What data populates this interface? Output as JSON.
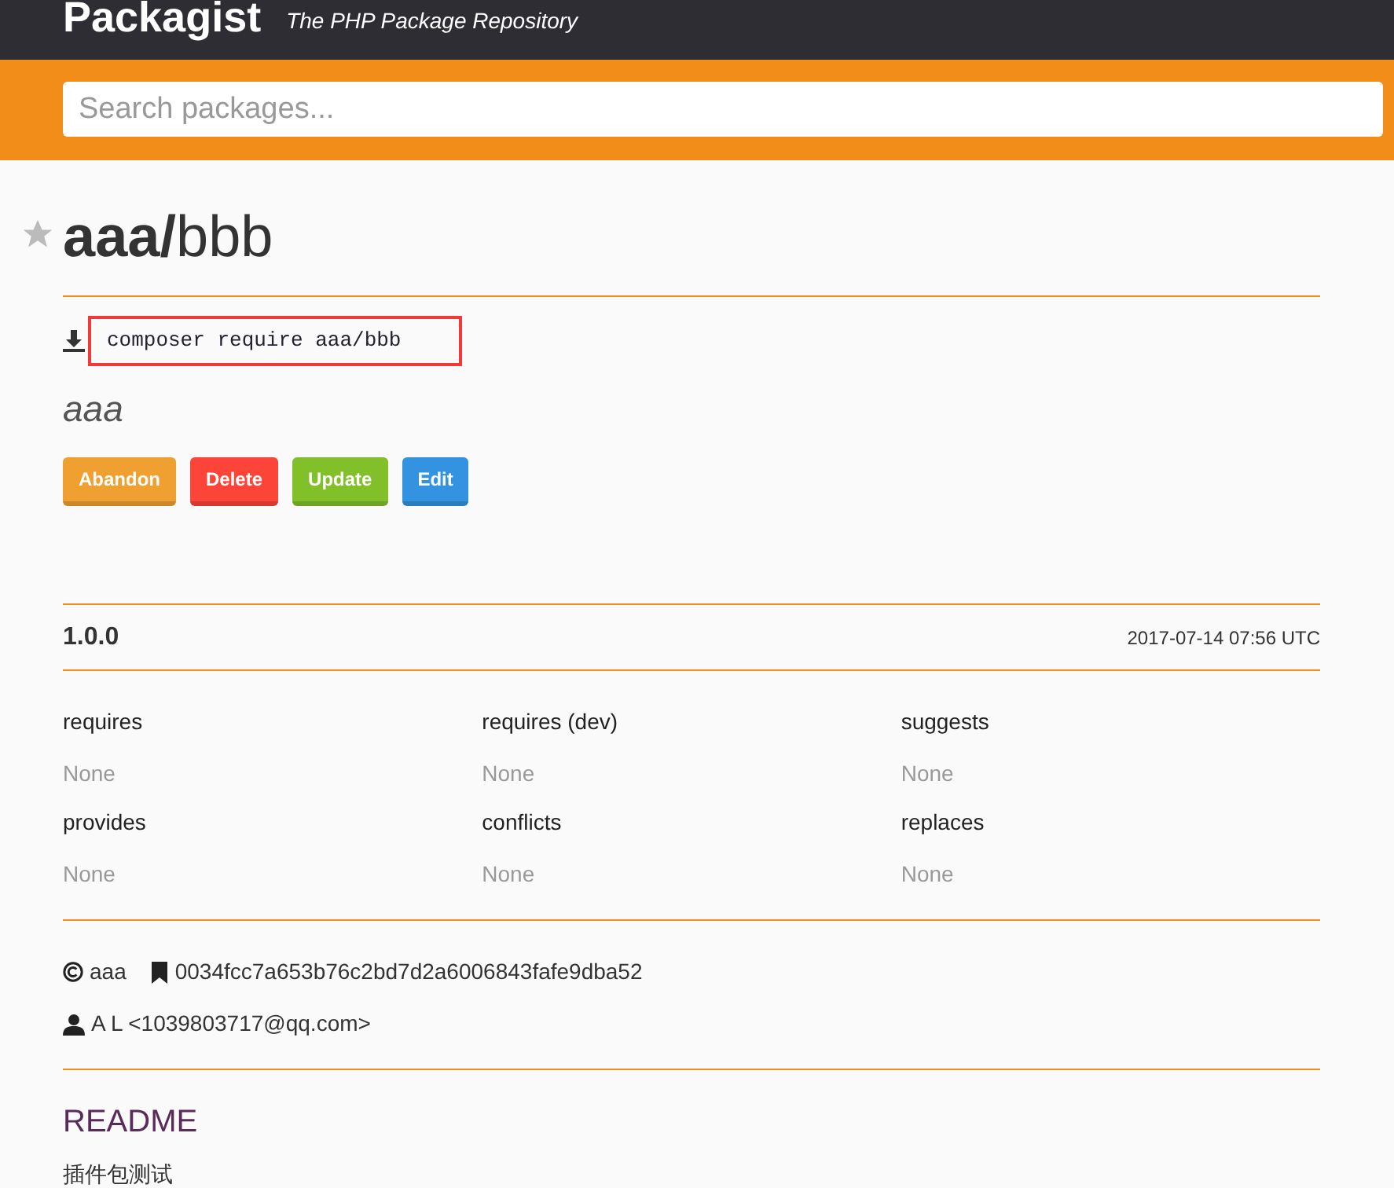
{
  "header": {
    "logo": "Packagist",
    "tagline": "The PHP Package Repository"
  },
  "search": {
    "placeholder": "Search packages..."
  },
  "package": {
    "vendor": "aaa/",
    "name": "bbb",
    "favorited": false,
    "install_command": "composer require aaa/bbb",
    "description": "aaa"
  },
  "buttons": [
    {
      "label": "Abandon",
      "color": "#f0a030"
    },
    {
      "label": "Delete",
      "color": "#fc4538"
    },
    {
      "label": "Update",
      "color": "#82c02a"
    },
    {
      "label": "Edit",
      "color": "#3493e0"
    }
  ],
  "version": {
    "number": "1.0.0",
    "released": "2017-07-14 07:56 UTC"
  },
  "links": [
    {
      "heading": "requires",
      "value": "None"
    },
    {
      "heading": "requires (dev)",
      "value": "None"
    },
    {
      "heading": "suggests",
      "value": "None"
    },
    {
      "heading": "provides",
      "value": "None"
    },
    {
      "heading": "conflicts",
      "value": "None"
    },
    {
      "heading": "replaces",
      "value": "None"
    }
  ],
  "meta": {
    "license": "aaa",
    "reference": "0034fcc7a653b76c2bd7d2a6006843fafe9dba52",
    "author": "A L <1039803717@qq.com>"
  },
  "readme": {
    "title": "README",
    "body": "插件包测试"
  }
}
